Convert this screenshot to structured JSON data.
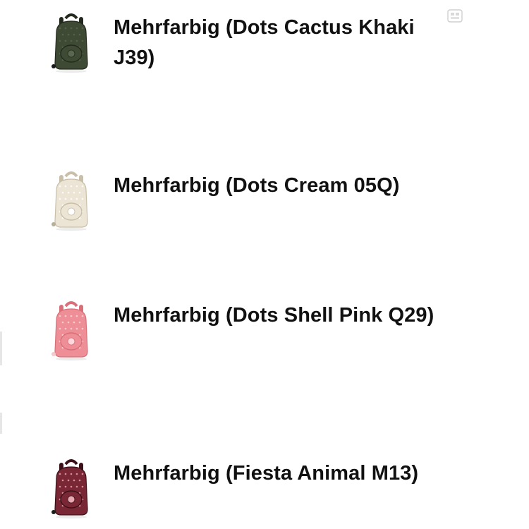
{
  "variants": [
    {
      "label": "Mehrfarbig (Dots Cactus Khaki J39)",
      "icon": "backpack-icon",
      "colors": {
        "body": "#3f4a34",
        "dark": "#232a1d",
        "pattern": "#5a6650",
        "accent": "#1a1a1a"
      }
    },
    {
      "label": "Mehrfarbig (Dots Cream 05Q)",
      "icon": "backpack-icon",
      "colors": {
        "body": "#ece5d6",
        "dark": "#c9bfa8",
        "pattern": "#ffffff",
        "accent": "#b9ae97"
      }
    },
    {
      "label": "Mehrfarbig (Dots Shell Pink Q29)",
      "icon": "backpack-icon",
      "colors": {
        "body": "#ee8f97",
        "dark": "#d96f79",
        "pattern": "#ffd7dc",
        "accent": "#f6c8cc"
      }
    },
    {
      "label": "Mehrfarbig (Fiesta Animal M13)",
      "icon": "backpack-icon",
      "colors": {
        "body": "#7a2735",
        "dark": "#3b1119",
        "pattern": "#e8a9b2",
        "accent": "#1c1c1c"
      }
    }
  ],
  "corner_icon": "image-placeholder-icon"
}
